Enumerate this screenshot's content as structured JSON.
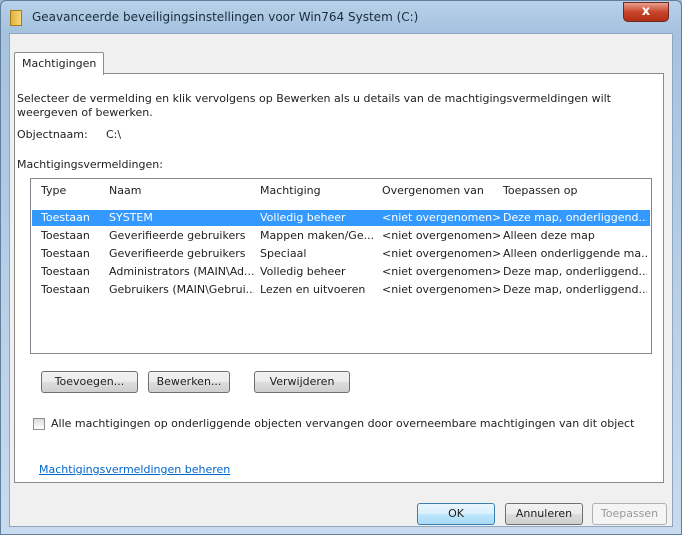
{
  "window": {
    "title": "Geavanceerde beveiligingsinstellingen voor Win764 System  (C:)",
    "close_label": "x"
  },
  "tab": {
    "label": "Machtigingen"
  },
  "instructions": "Selecteer de vermelding en klik vervolgens op Bewerken als u details van de machtigingsvermeldingen wilt weergeven of bewerken.",
  "object": {
    "label": "Objectnaam:",
    "value": "C:\\"
  },
  "entries": {
    "label": "Machtigingsvermeldingen:",
    "columns": [
      "Type",
      "Naam",
      "Machtiging",
      "Overgenomen van",
      "Toepassen op"
    ],
    "rows": [
      {
        "type": "Toestaan",
        "name": "SYSTEM",
        "permission": "Volledig beheer",
        "inherited": "<niet overgenomen>",
        "apply": "Deze map, onderliggend...",
        "selected": true
      },
      {
        "type": "Toestaan",
        "name": "Geverifieerde gebruikers",
        "permission": "Mappen maken/Ge...",
        "inherited": "<niet overgenomen>",
        "apply": "Alleen deze map",
        "selected": false
      },
      {
        "type": "Toestaan",
        "name": "Geverifieerde gebruikers",
        "permission": "Speciaal",
        "inherited": "<niet overgenomen>",
        "apply": "Alleen onderliggende ma...",
        "selected": false
      },
      {
        "type": "Toestaan",
        "name": "Administrators (MAIN\\Ad...",
        "permission": "Volledig beheer",
        "inherited": "<niet overgenomen>",
        "apply": "Deze map, onderliggend...",
        "selected": false
      },
      {
        "type": "Toestaan",
        "name": "Gebruikers (MAIN\\Gebrui...",
        "permission": "Lezen en uitvoeren",
        "inherited": "<niet overgenomen>",
        "apply": "Deze map, onderliggend...",
        "selected": false
      }
    ]
  },
  "buttons": {
    "add": "Toevoegen...",
    "edit": "Bewerken...",
    "remove": "Verwijderen",
    "ok": "OK",
    "cancel": "Annuleren",
    "apply": "Toepassen"
  },
  "checkbox": {
    "label": "Alle machtigingen op onderliggende objecten vervangen door overneembare machtigingen van dit object",
    "checked": false
  },
  "manage_link": "Machtigingsvermeldingen beheren",
  "colors": {
    "selection": "#3399ff",
    "link": "#0066cc",
    "close_button": "#c8442b"
  }
}
